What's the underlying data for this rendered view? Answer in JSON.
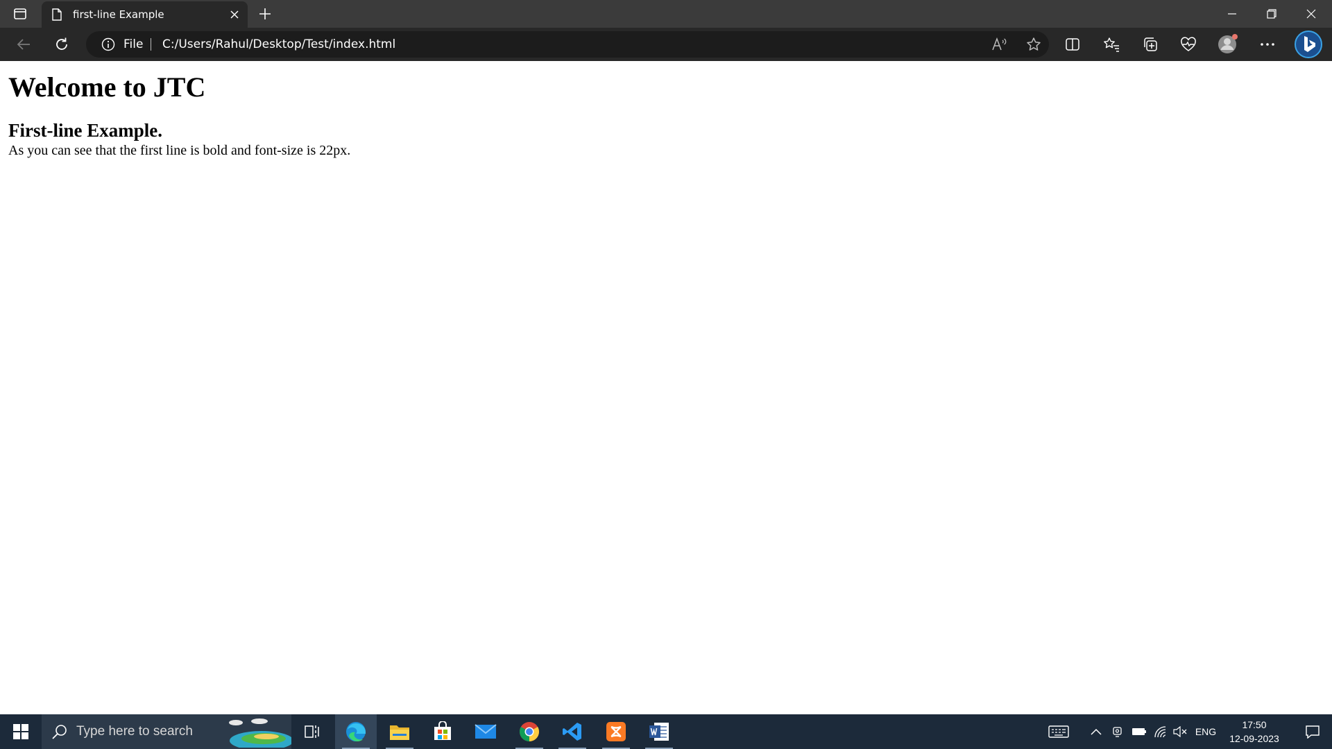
{
  "browser": {
    "tab": {
      "title": "first-line Example"
    },
    "omnibox": {
      "scheme_label": "File",
      "url": "C:/Users/Rahul/Desktop/Test/index.html"
    },
    "icons": {
      "tab_actions": "tab-actions-icon",
      "page": "page-icon",
      "close_tab": "close-icon",
      "new_tab": "plus-icon",
      "minimize": "minimize-icon",
      "restore": "restore-icon",
      "close_window": "close-icon",
      "back": "back-arrow-icon",
      "refresh": "refresh-icon",
      "site_info": "info-icon",
      "read_aloud": "read-aloud-icon",
      "favorite": "star-icon",
      "split_screen": "split-screen-icon",
      "favorites": "favorites-icon",
      "collections": "collections-icon",
      "browser_essentials": "heart-pulse-icon",
      "profile": "profile-icon",
      "more": "more-icon",
      "copilot": "bing-icon"
    }
  },
  "page": {
    "heading": "Welcome to JTC",
    "subheading": "First-line Example.",
    "paragraph": "As you can see that the first line is bold and font-size is 22px."
  },
  "taskbar": {
    "search_placeholder": "Type here to search",
    "apps": [
      "task-view",
      "edge",
      "file-explorer",
      "microsoft-store",
      "mail",
      "chrome",
      "vscode",
      "xampp",
      "word"
    ],
    "tray": {
      "language": "ENG",
      "time": "17:50",
      "date": "12-09-2023"
    }
  },
  "colors": {
    "tabstrip": "#3b3b3b",
    "toolbar": "#282828",
    "omnibox": "#1c1c1c",
    "taskbar": "#1c2a3a"
  }
}
